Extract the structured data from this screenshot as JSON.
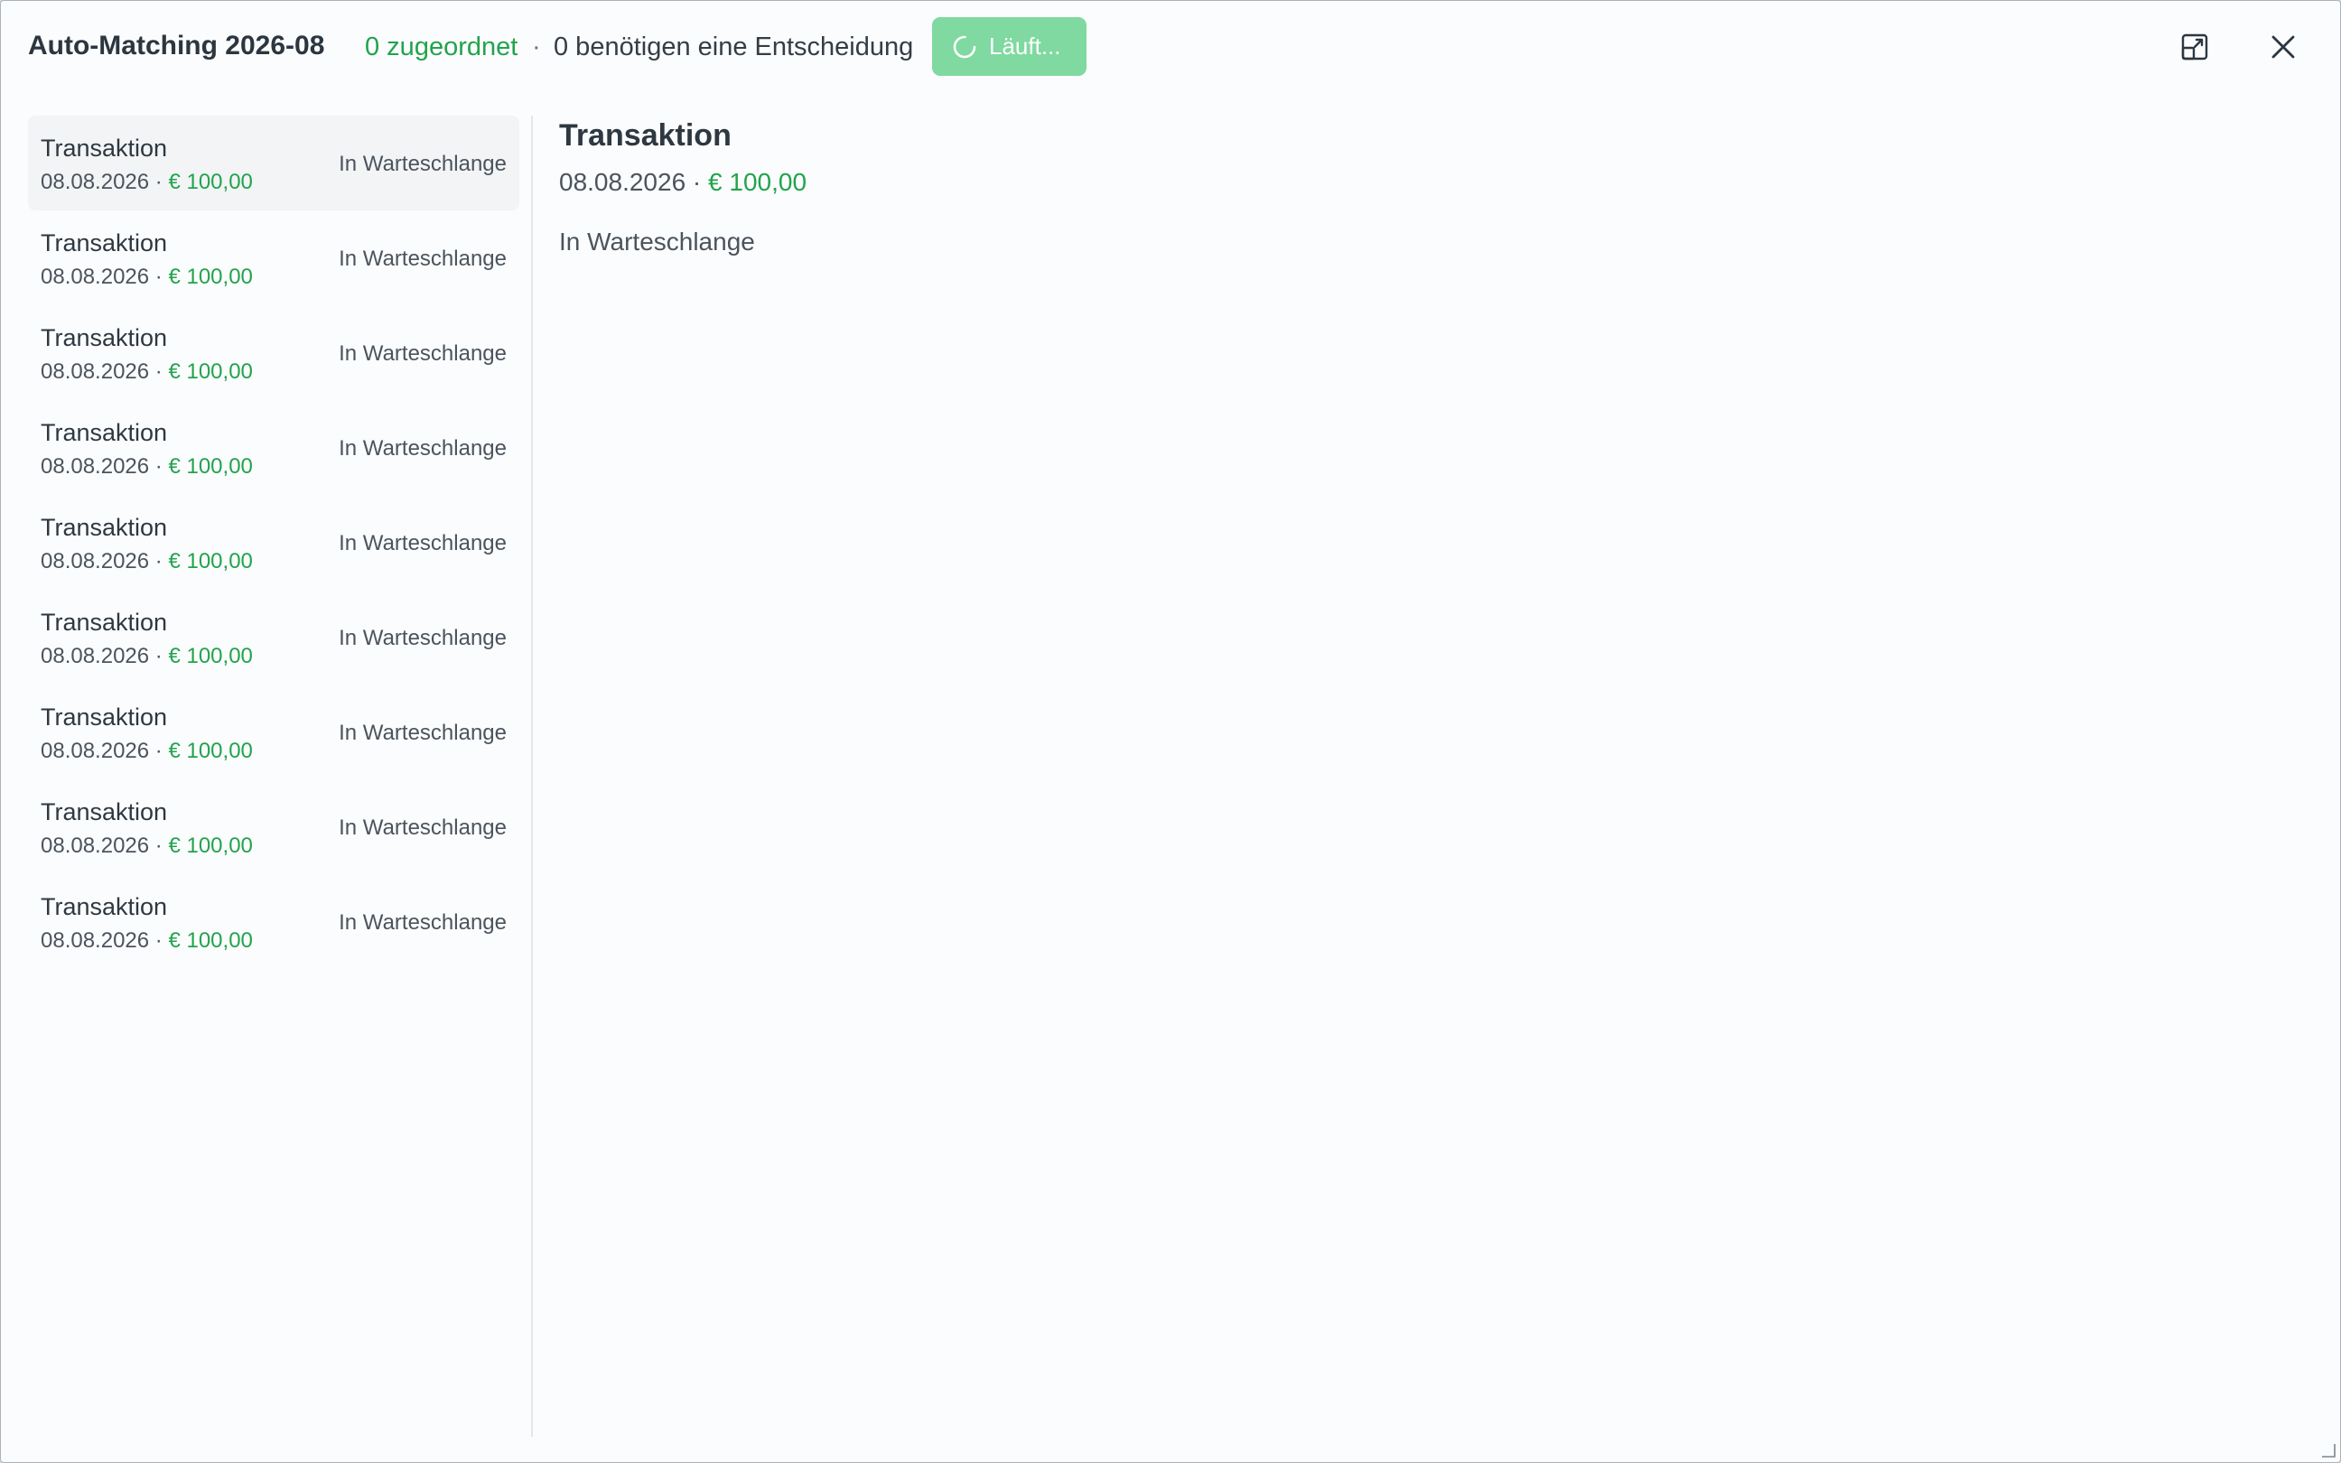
{
  "header": {
    "title": "Auto-Matching 2026-08",
    "assigned_text": "0 zugeordnet",
    "separator": "·",
    "decision_text": "0 benötigen eine Entscheidung",
    "run_button_label": "Läuft...",
    "icons": {
      "expand": "open-in-window-icon",
      "close": "close-icon"
    }
  },
  "colors": {
    "accent_green": "#22a34d",
    "button_green": "#7fd9a0",
    "text_dark": "#2e3841"
  },
  "transactions": [
    {
      "title": "Transaktion",
      "date": "08.08.2026",
      "dot": "·",
      "amount": "€ 100,00",
      "status": "In Warteschlange",
      "selected": true
    },
    {
      "title": "Transaktion",
      "date": "08.08.2026",
      "dot": "·",
      "amount": "€ 100,00",
      "status": "In Warteschlange"
    },
    {
      "title": "Transaktion",
      "date": "08.08.2026",
      "dot": "·",
      "amount": "€ 100,00",
      "status": "In Warteschlange"
    },
    {
      "title": "Transaktion",
      "date": "08.08.2026",
      "dot": "·",
      "amount": "€ 100,00",
      "status": "In Warteschlange"
    },
    {
      "title": "Transaktion",
      "date": "08.08.2026",
      "dot": "·",
      "amount": "€ 100,00",
      "status": "In Warteschlange"
    },
    {
      "title": "Transaktion",
      "date": "08.08.2026",
      "dot": "·",
      "amount": "€ 100,00",
      "status": "In Warteschlange"
    },
    {
      "title": "Transaktion",
      "date": "08.08.2026",
      "dot": "·",
      "amount": "€ 100,00",
      "status": "In Warteschlange"
    },
    {
      "title": "Transaktion",
      "date": "08.08.2026",
      "dot": "·",
      "amount": "€ 100,00",
      "status": "In Warteschlange"
    },
    {
      "title": "Transaktion",
      "date": "08.08.2026",
      "dot": "·",
      "amount": "€ 100,00",
      "status": "In Warteschlange"
    }
  ],
  "detail": {
    "title": "Transaktion",
    "date": "08.08.2026",
    "dot": "·",
    "amount": "€ 100,00",
    "status": "In Warteschlange"
  }
}
